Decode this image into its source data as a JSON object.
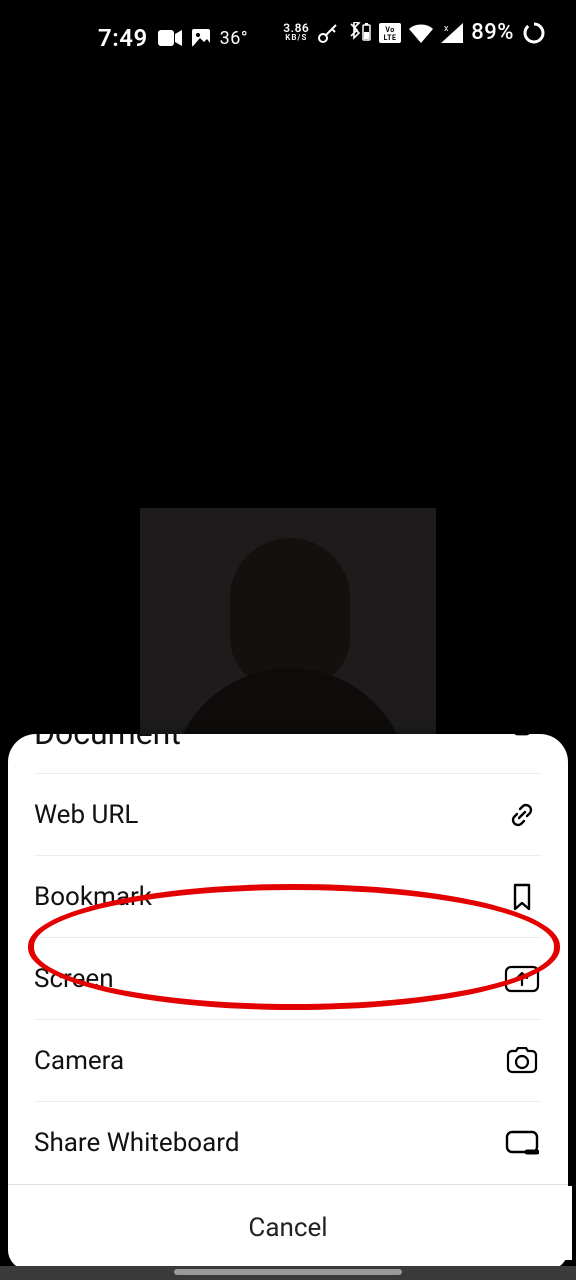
{
  "status": {
    "time": "7:49",
    "temp": "36°",
    "net_speed": "3.86",
    "net_unit": "KB/S",
    "battery_pct": "89%"
  },
  "menu": {
    "document": "Document",
    "web_url": "Web URL",
    "bookmark": "Bookmark",
    "screen": "Screen",
    "camera": "Camera",
    "whiteboard": "Share Whiteboard",
    "cancel": "Cancel"
  }
}
